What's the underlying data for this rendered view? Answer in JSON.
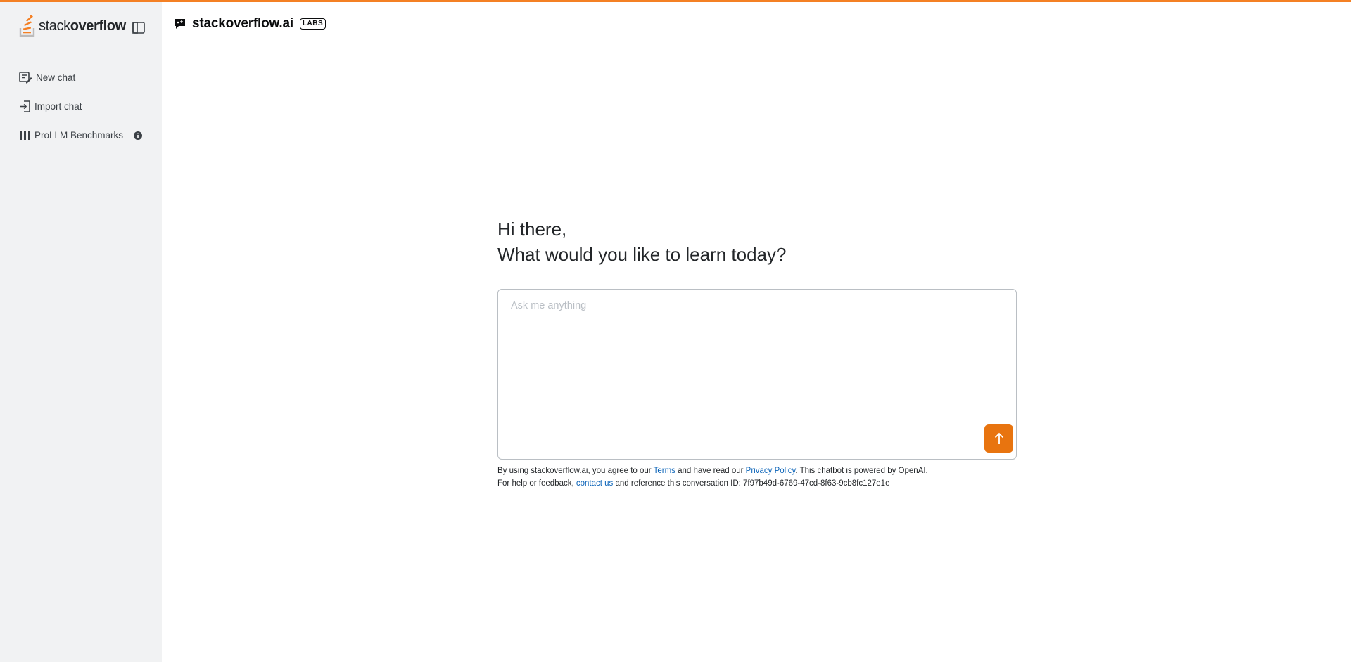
{
  "colors": {
    "accent": "#f48024",
    "send_button": "#e8740f",
    "link": "#0a63b8",
    "sidebar_bg": "#f1f2f3"
  },
  "sidebar": {
    "logo": {
      "prefix": "stack",
      "bold": "overflow",
      "icon": "stackoverflow-logo-icon"
    },
    "toggle_icon": "sidebar-toggle-icon",
    "items": [
      {
        "label": "New chat",
        "icon": "new-chat-icon"
      },
      {
        "label": "Import chat",
        "icon": "import-icon"
      },
      {
        "label": "ProLLM Benchmarks",
        "icon": "columns-icon",
        "trailing_icon": "info-icon"
      }
    ]
  },
  "header": {
    "title": "stackoverflow.ai",
    "badge": "LABS",
    "icon": "chat-bubble-icon"
  },
  "main": {
    "greeting_line1": "Hi there,",
    "greeting_line2": "What would you like to learn today?",
    "input": {
      "placeholder": "Ask me anything",
      "value": ""
    },
    "send_icon": "arrow-up-icon"
  },
  "footer": {
    "line1_a": "By using stackoverflow.ai, you agree to our ",
    "terms": "Terms",
    "line1_b": " and have read our ",
    "privacy": "Privacy Policy",
    "line1_c": ". This chatbot is powered by OpenAI.",
    "line2_a": "For help or feedback, ",
    "contact": "contact us",
    "line2_b": " and reference this conversation ID: 7f97b49d-6769-47cd-8f63-9cb8fc127e1e"
  }
}
